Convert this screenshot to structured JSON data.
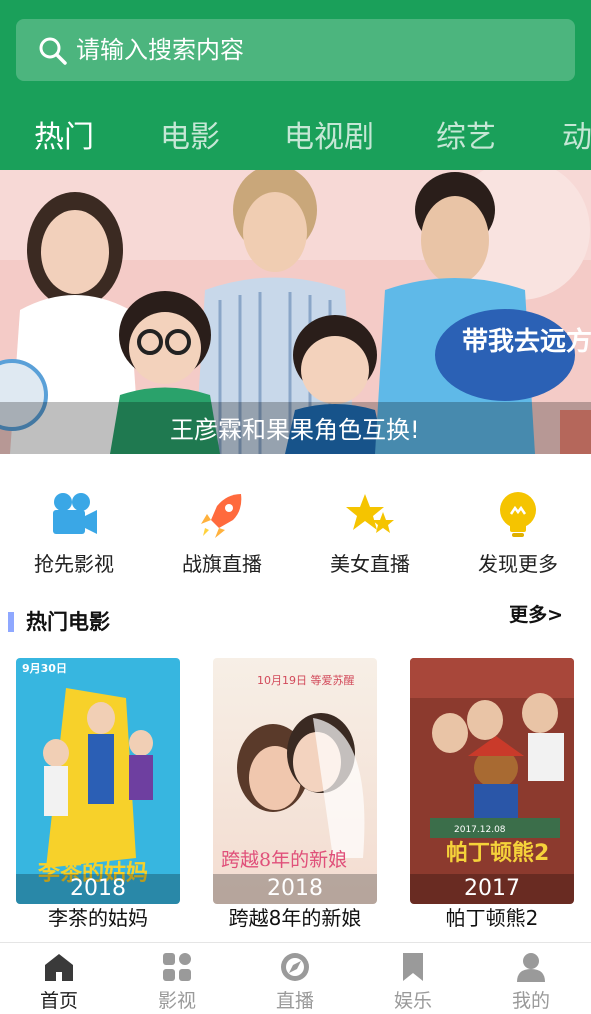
{
  "search": {
    "placeholder": "请输入搜索内容"
  },
  "tabs": [
    {
      "label": "热门",
      "active": true
    },
    {
      "label": "电影"
    },
    {
      "label": "电视剧"
    },
    {
      "label": "综艺"
    },
    {
      "label": "动"
    }
  ],
  "banner": {
    "caption": "王彦霖和果果角色互换!",
    "logo_text": "带我去远方"
  },
  "quick": [
    {
      "label": "抢先影视",
      "icon": "camera-icon",
      "color": "#3aa7e6"
    },
    {
      "label": "战旗直播",
      "icon": "rocket-icon",
      "color": "#ff6a3d"
    },
    {
      "label": "美女直播",
      "icon": "stars-icon",
      "color": "#f5c400"
    },
    {
      "label": "发现更多",
      "icon": "bulb-icon",
      "color": "#f5c400"
    }
  ],
  "section": {
    "title": "热门电影",
    "more": "更多>"
  },
  "movies": [
    {
      "title": "李茶的姑妈",
      "year": "2018",
      "poster_date": "9月30日",
      "poster_title": "李茶的姑妈"
    },
    {
      "title": "跨越8年的新娘",
      "year": "2018",
      "poster_date": "10月19日 等爱苏醒",
      "poster_title": "跨越8年的新娘"
    },
    {
      "title": "帕丁顿熊2",
      "year": "2017",
      "poster_date": "2017.12.08",
      "poster_title": "帕丁顿熊2"
    }
  ],
  "nav": [
    {
      "label": "首页",
      "icon": "home-icon",
      "active": true
    },
    {
      "label": "影视",
      "icon": "grid-icon"
    },
    {
      "label": "直播",
      "icon": "compass-icon"
    },
    {
      "label": "娱乐",
      "icon": "bookmark-icon"
    },
    {
      "label": "我的",
      "icon": "user-icon"
    }
  ],
  "colors": {
    "header": "#1aa05a",
    "accent_bar": "#8fa8ff"
  }
}
